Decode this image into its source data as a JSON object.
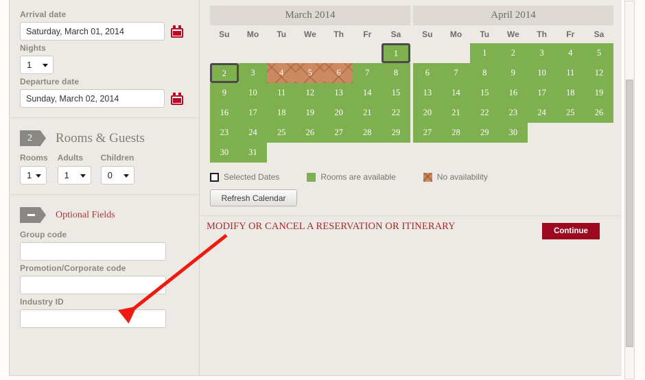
{
  "sidebar": {
    "arrival": {
      "label": "Arrival date",
      "value": "Saturday, March 01, 2014",
      "placeholder": "",
      "icon": "calendar-icon"
    },
    "nights": {
      "label": "Nights",
      "value": "1"
    },
    "departure": {
      "label": "Departure date",
      "value": "Sunday, March 02, 2014",
      "placeholder": "",
      "icon": "calendar-icon"
    },
    "rooms_guests": {
      "step_number": "2",
      "title": "Rooms & Guests",
      "rooms": {
        "label": "Rooms",
        "value": "1"
      },
      "adults": {
        "label": "Adults",
        "value": "1"
      },
      "children": {
        "label": "Children",
        "value": "0"
      }
    },
    "optional": {
      "toggle_icon": "minus-icon",
      "title": "Optional Fields",
      "group_code": {
        "label": "Group code",
        "value": "",
        "placeholder": ""
      },
      "promo_code": {
        "label": "Promotion/Corporate code",
        "value": "",
        "placeholder": ""
      },
      "industry_id": {
        "label": "Industry ID",
        "value": "",
        "placeholder": ""
      }
    }
  },
  "calendars": [
    {
      "title": "March 2014",
      "dow": [
        "Su",
        "Mo",
        "Tu",
        "We",
        "Th",
        "Fr",
        "Sa"
      ],
      "weeks": [
        [
          {
            "n": "",
            "state": "empty"
          },
          {
            "n": "",
            "state": "empty"
          },
          {
            "n": "",
            "state": "empty"
          },
          {
            "n": "",
            "state": "empty"
          },
          {
            "n": "",
            "state": "empty"
          },
          {
            "n": "",
            "state": "empty"
          },
          {
            "n": "1",
            "state": "avail",
            "selected": true
          }
        ],
        [
          {
            "n": "2",
            "state": "avail",
            "selected": true
          },
          {
            "n": "3",
            "state": "avail"
          },
          {
            "n": "4",
            "state": "noavail"
          },
          {
            "n": "5",
            "state": "noavail"
          },
          {
            "n": "6",
            "state": "noavail"
          },
          {
            "n": "7",
            "state": "avail"
          },
          {
            "n": "8",
            "state": "avail"
          }
        ],
        [
          {
            "n": "9",
            "state": "avail"
          },
          {
            "n": "10",
            "state": "avail"
          },
          {
            "n": "11",
            "state": "avail"
          },
          {
            "n": "12",
            "state": "avail"
          },
          {
            "n": "13",
            "state": "avail"
          },
          {
            "n": "14",
            "state": "avail"
          },
          {
            "n": "15",
            "state": "avail"
          }
        ],
        [
          {
            "n": "16",
            "state": "avail"
          },
          {
            "n": "17",
            "state": "avail"
          },
          {
            "n": "18",
            "state": "avail"
          },
          {
            "n": "19",
            "state": "avail"
          },
          {
            "n": "20",
            "state": "avail"
          },
          {
            "n": "21",
            "state": "avail"
          },
          {
            "n": "22",
            "state": "avail"
          }
        ],
        [
          {
            "n": "23",
            "state": "avail"
          },
          {
            "n": "24",
            "state": "avail"
          },
          {
            "n": "25",
            "state": "avail"
          },
          {
            "n": "26",
            "state": "avail"
          },
          {
            "n": "27",
            "state": "avail"
          },
          {
            "n": "28",
            "state": "avail"
          },
          {
            "n": "29",
            "state": "avail"
          }
        ],
        [
          {
            "n": "30",
            "state": "avail"
          },
          {
            "n": "31",
            "state": "avail"
          },
          {
            "n": "",
            "state": "empty"
          },
          {
            "n": "",
            "state": "empty"
          },
          {
            "n": "",
            "state": "empty"
          },
          {
            "n": "",
            "state": "empty"
          },
          {
            "n": "",
            "state": "empty"
          }
        ]
      ]
    },
    {
      "title": "April 2014",
      "dow": [
        "Su",
        "Mo",
        "Tu",
        "We",
        "Th",
        "Fr",
        "Sa"
      ],
      "weeks": [
        [
          {
            "n": "",
            "state": "empty"
          },
          {
            "n": "",
            "state": "empty"
          },
          {
            "n": "1",
            "state": "avail"
          },
          {
            "n": "2",
            "state": "avail"
          },
          {
            "n": "3",
            "state": "avail"
          },
          {
            "n": "4",
            "state": "avail"
          },
          {
            "n": "5",
            "state": "avail"
          }
        ],
        [
          {
            "n": "6",
            "state": "avail"
          },
          {
            "n": "7",
            "state": "avail"
          },
          {
            "n": "8",
            "state": "avail"
          },
          {
            "n": "9",
            "state": "avail"
          },
          {
            "n": "10",
            "state": "avail"
          },
          {
            "n": "11",
            "state": "avail"
          },
          {
            "n": "12",
            "state": "avail"
          }
        ],
        [
          {
            "n": "13",
            "state": "avail"
          },
          {
            "n": "14",
            "state": "avail"
          },
          {
            "n": "15",
            "state": "avail"
          },
          {
            "n": "16",
            "state": "avail"
          },
          {
            "n": "17",
            "state": "avail"
          },
          {
            "n": "18",
            "state": "avail"
          },
          {
            "n": "19",
            "state": "avail"
          }
        ],
        [
          {
            "n": "20",
            "state": "avail"
          },
          {
            "n": "21",
            "state": "avail"
          },
          {
            "n": "22",
            "state": "avail"
          },
          {
            "n": "23",
            "state": "avail"
          },
          {
            "n": "24",
            "state": "avail"
          },
          {
            "n": "25",
            "state": "avail"
          },
          {
            "n": "26",
            "state": "avail"
          }
        ],
        [
          {
            "n": "27",
            "state": "avail"
          },
          {
            "n": "28",
            "state": "avail"
          },
          {
            "n": "29",
            "state": "avail"
          },
          {
            "n": "30",
            "state": "avail"
          },
          {
            "n": "",
            "state": "empty"
          },
          {
            "n": "",
            "state": "empty"
          },
          {
            "n": "",
            "state": "empty"
          }
        ]
      ]
    }
  ],
  "legend": [
    {
      "swatch": "selected",
      "label": "Selected Dates"
    },
    {
      "swatch": "green",
      "label": "Rooms are available"
    },
    {
      "swatch": "hatch",
      "label": "No availability"
    }
  ],
  "actions": {
    "refresh_label": "Refresh Calendar",
    "modify_link": "MODIFY OR CANCEL A RESERVATION OR ITINERARY",
    "continue_label": "Continue"
  },
  "colors": {
    "available_green": "#7fb04f",
    "no_availability": "#cd8a62",
    "selected_border": "#4a4a4a",
    "brand_red": "#9c0a20",
    "link_red": "#a32b2b",
    "annotation_red": "#ee1b11",
    "panel_bg": "#edeae6"
  },
  "annotation": {
    "type": "arrow",
    "points_to": "promotion-corporate-code-field"
  }
}
